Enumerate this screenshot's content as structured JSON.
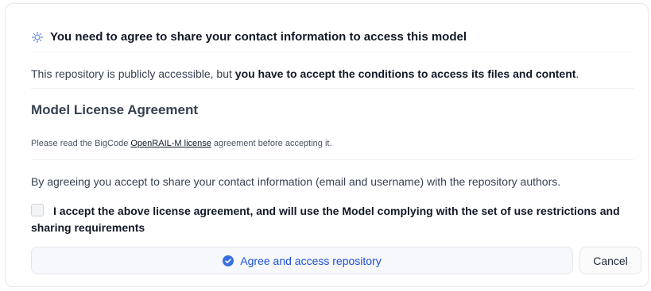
{
  "gate": {
    "title": "You need to agree to share your contact information to access this model",
    "intro_prefix": "This repository is publicly accessible, but ",
    "intro_bold": "you have to accept the conditions to access its files and content",
    "intro_suffix": "."
  },
  "license": {
    "heading": "Model License Agreement",
    "note_prefix": "Please read the BigCode ",
    "note_link": "OpenRAIL-M license",
    "note_suffix": " agreement before accepting it."
  },
  "consent": {
    "text": "By agreeing you accept to share your contact information (email and username) with the repository authors.",
    "checkbox_label": "I accept the above license agreement, and will use the Model complying with the set of use restrictions and sharing requirements",
    "checked": false
  },
  "actions": {
    "agree_label": "Agree and access repository",
    "cancel_label": "Cancel"
  },
  "icons": {
    "header_icon": "gate-icon",
    "agree_icon": "check-circle-icon"
  },
  "colors": {
    "accent": "#1d4ed8",
    "check_icon": "#3b6fe0"
  }
}
